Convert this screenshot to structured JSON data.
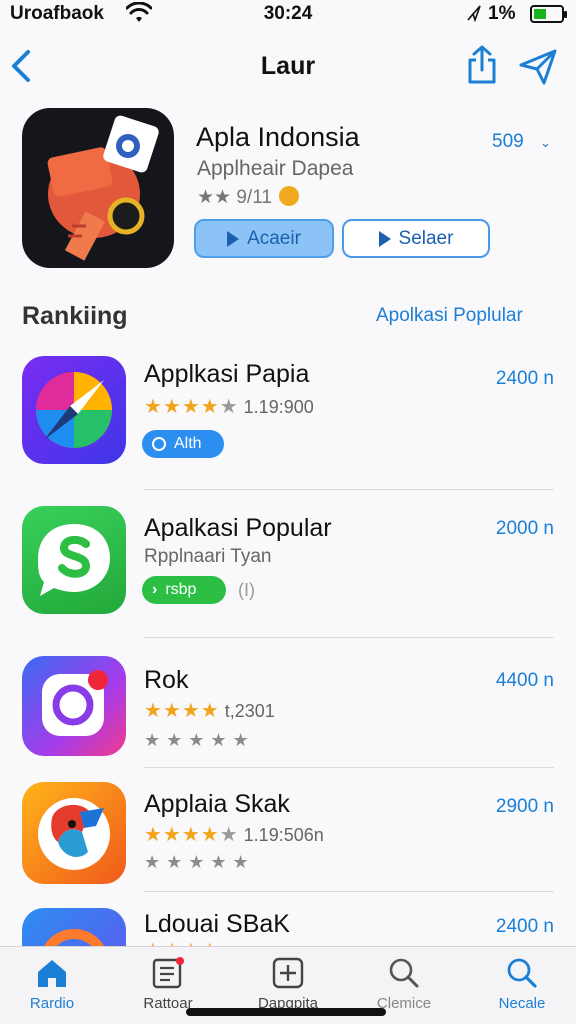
{
  "status_bar": {
    "carrier": "Uroafbaok",
    "time": "30:24",
    "battery_percent": "1%",
    "icons": [
      "wifi-icon",
      "location-arrow-icon",
      "battery-icon"
    ]
  },
  "nav": {
    "title": "Laur",
    "icons": [
      "chevron-left-icon",
      "share-icon",
      "send-icon"
    ]
  },
  "hero": {
    "name": "Apla Indonsia",
    "subtitle": "Applheair Dapea",
    "rating": "★★ 9/11",
    "count": "509",
    "chevron": "⌄",
    "primary_button": "Acaeir",
    "secondary_button": "Selaer"
  },
  "section": {
    "title": "Rankiing",
    "link": "Apolkasi Poplular"
  },
  "apps": [
    {
      "name": "Applkasi Papia",
      "count": "2400 n",
      "rating_text": "1.19:900",
      "stars_full": "★★★★",
      "stars_dim": "★",
      "badge": "Alth",
      "color": "#5b2ef0"
    },
    {
      "name": "Apalkasi Popular",
      "count": "2000 n",
      "subtitle": "Rpplnaari Tyan",
      "badge": "rsbp",
      "badge_extra": "(I)",
      "color": "#2cbf43"
    },
    {
      "name": "Rok",
      "count": "4400 n",
      "rating_text": "t,2301",
      "stars_full": "★★★★",
      "stars_dim": "",
      "gray_stars": "★★★★★",
      "color": "#8a3be8"
    },
    {
      "name": "Applaia Skak",
      "count": "2900 n",
      "rating_text": "1.19:506n",
      "stars_full": "★★★★",
      "stars_dim": "★",
      "gray_stars": "★★★★★",
      "color": "#f07a1c"
    },
    {
      "name": "Ldouai SBaK",
      "count": "2400 n",
      "stars_full": "★★★★",
      "color": "#2b8ef0"
    }
  ],
  "tabs": [
    {
      "label": "Rardio",
      "icon": "home-icon",
      "active": true
    },
    {
      "label": "Rattoar",
      "icon": "newspaper-icon",
      "active": false
    },
    {
      "label": "Dapgpita",
      "icon": "plus-square-icon",
      "active": false
    },
    {
      "label": "Clemice",
      "icon": "search-icon",
      "active": false
    },
    {
      "label": "Necale",
      "icon": "search-icon",
      "active": true
    }
  ],
  "colors": {
    "accent": "#1c7fd6",
    "star": "#f2a51c",
    "battery": "#19b31c"
  }
}
